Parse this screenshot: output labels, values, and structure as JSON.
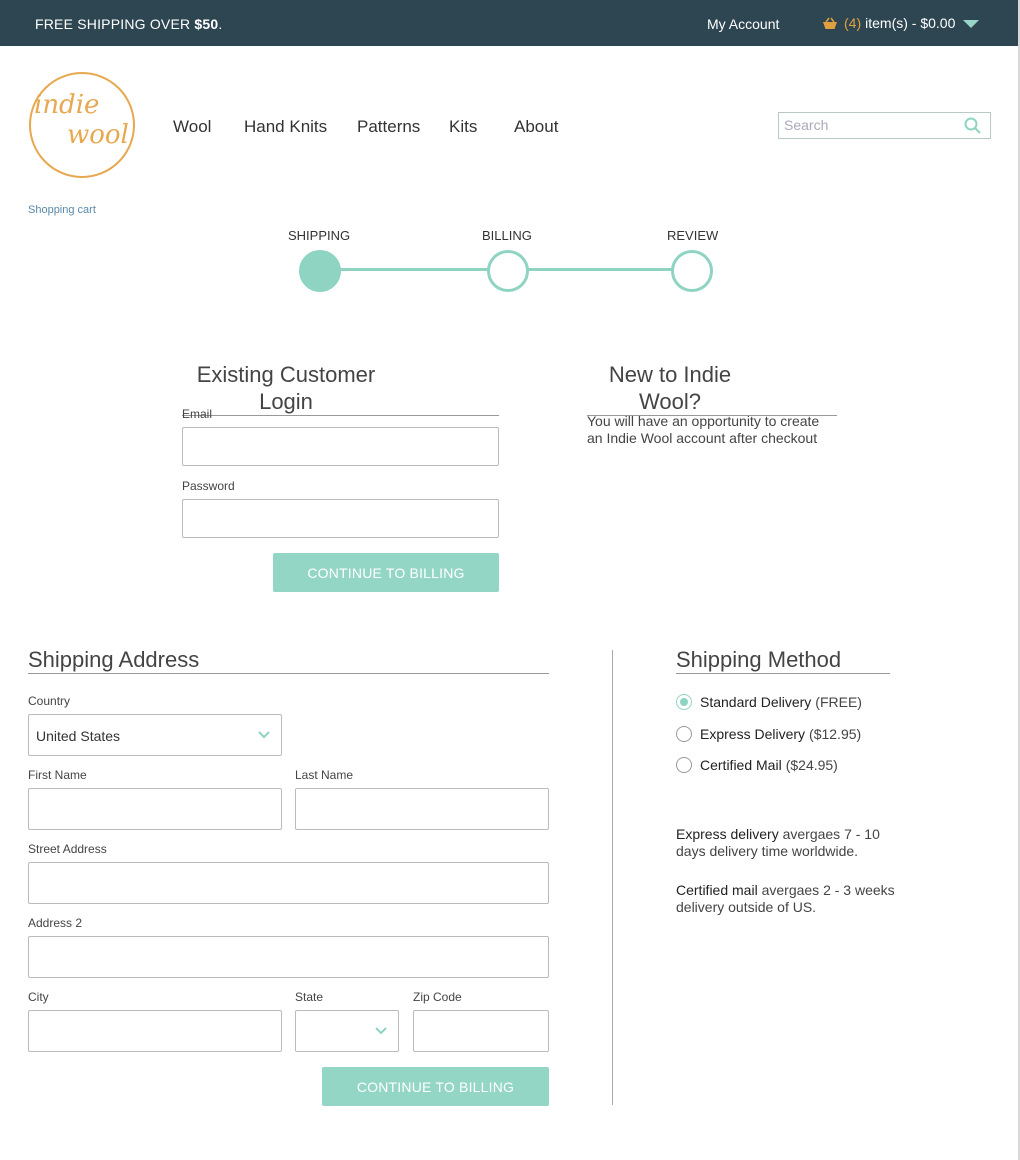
{
  "topbar": {
    "promo_prefix": "FREE SHIPPING OVER ",
    "promo_amount": "$50",
    "promo_suffix": ".",
    "account_label": "My Account",
    "cart_count": "(4)",
    "cart_label": "item(s) - $0.00"
  },
  "logo": {
    "line1": "indie",
    "line2": "wool"
  },
  "nav": {
    "items": [
      "Wool",
      "Hand Knits",
      "Patterns",
      "Kits",
      "About"
    ]
  },
  "search": {
    "placeholder": "Search"
  },
  "breadcrumb": "Shopping cart",
  "steps": [
    "SHIPPING",
    "BILLING",
    "REVIEW"
  ],
  "login": {
    "title": "Existing Customer Login",
    "email_label": "Email",
    "password_label": "Password",
    "button": "CONTINUE TO BILLING"
  },
  "new_customer": {
    "title": "New to Indie Wool?",
    "text": "You will have an opportunity to create an Indie Wool account after checkout"
  },
  "shipping_address": {
    "title": "Shipping Address",
    "country_label": "Country",
    "country_value": "United States",
    "first_name_label": "First Name",
    "last_name_label": "Last Name",
    "street_label": "Street Address",
    "address2_label": "Address 2",
    "city_label": "City",
    "state_label": "State",
    "zip_label": "Zip Code",
    "button": "CONTINUE TO BILLING"
  },
  "shipping_method": {
    "title": "Shipping Method",
    "options": [
      {
        "name": "Standard Delivery",
        "price": "(FREE)",
        "selected": true
      },
      {
        "name": "Express Delivery",
        "price": "($12.95)",
        "selected": false
      },
      {
        "name": "Certified Mail",
        "price": "($24.95)",
        "selected": false
      }
    ],
    "notes": [
      {
        "lead": "Express delivery",
        "rest": " avergaes 7 - 10 days delivery time worldwide."
      },
      {
        "lead": "Certified mail",
        "rest": " avergaes 2 - 3 weeks delivery outside of US."
      }
    ]
  },
  "colors": {
    "topbar": "#2e4652",
    "accent": "#8fd3c3",
    "logo": "#e8a850"
  }
}
